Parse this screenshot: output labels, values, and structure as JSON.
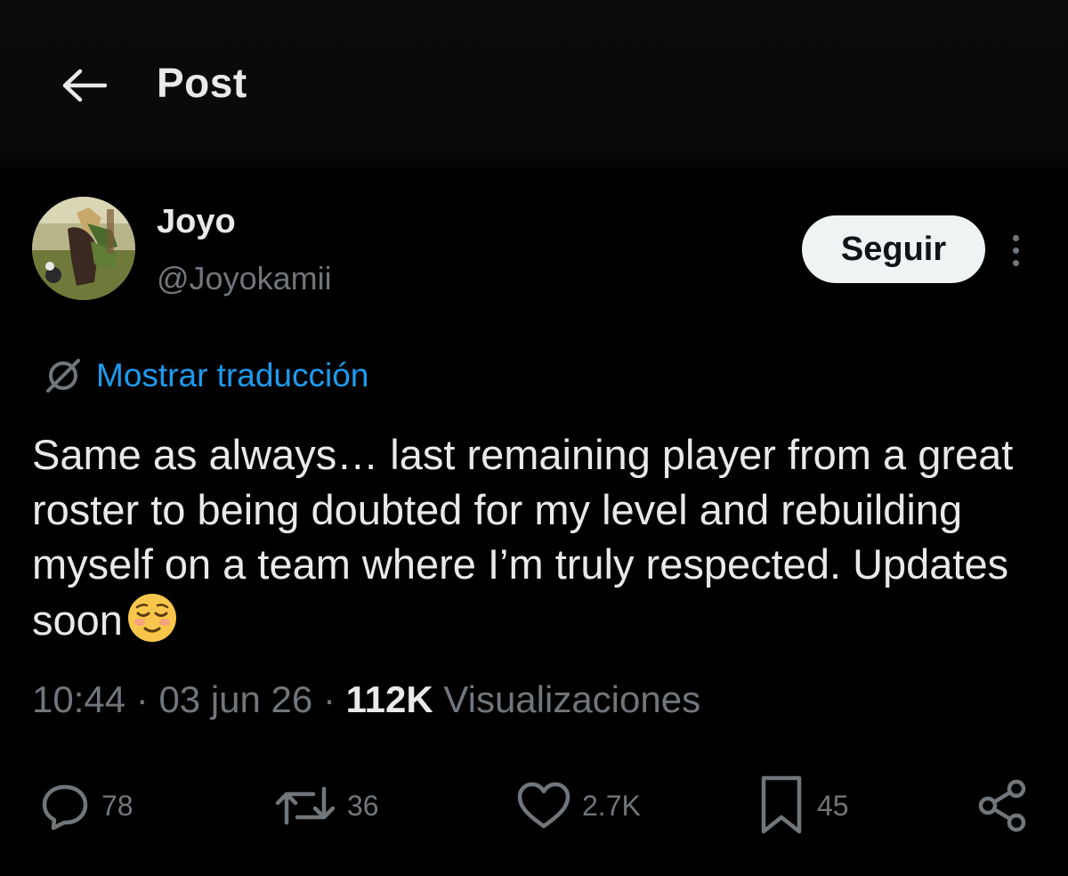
{
  "header": {
    "title": "Post",
    "back_icon": "arrow-left-icon"
  },
  "author": {
    "display_name": "Joyo",
    "handle": "@Joyokamii",
    "follow_label": "Seguir"
  },
  "translate": {
    "label": "Mostrar traducción",
    "icon": "globe-slash-icon"
  },
  "post": {
    "text": "Same as always… last remaining player from a great roster to being doubted for my level and rebuilding myself on a team where I’m truly respected. Updates soon",
    "emoji": "relieved-face-emoji"
  },
  "meta": {
    "time": "10:44",
    "date": "03 jun 26",
    "views_count": "112K",
    "views_label": "Visualizaciones"
  },
  "actions": {
    "replies": "78",
    "reposts": "36",
    "likes": "2.7K",
    "bookmarks": "45"
  },
  "colors": {
    "background": "#000000",
    "text": "#e7e9ea",
    "muted": "#71767b",
    "link": "#1d9bf0",
    "follow_bg": "#eff3f4"
  }
}
